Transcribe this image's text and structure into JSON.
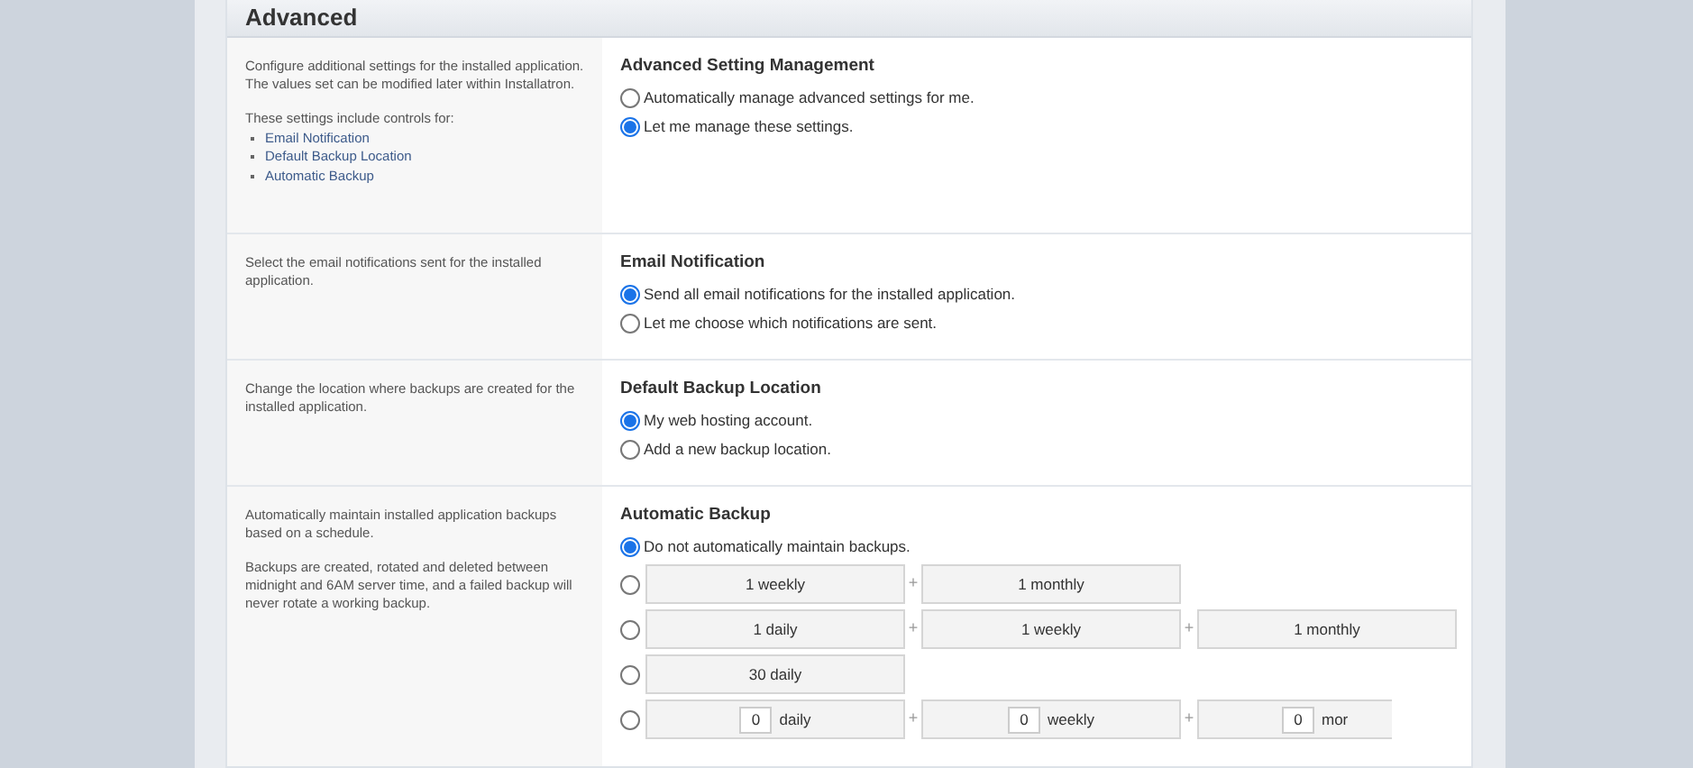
{
  "panel": {
    "title": "Advanced"
  },
  "sections": [
    {
      "description": [
        "Configure additional settings for the installed application. The values set can be modified later within Installatron.",
        "These settings include controls for:"
      ],
      "list": [
        "Email Notification",
        "Default Backup Location",
        "Automatic Backup"
      ],
      "heading": "Advanced Setting Management",
      "options": [
        {
          "kind": "text",
          "label": "Automatically manage advanced settings for me.",
          "selected": false
        },
        {
          "kind": "text",
          "label": "Let me manage these settings.",
          "selected": true
        }
      ]
    },
    {
      "description": [
        "Select the email notifications sent for the installed application."
      ],
      "heading": "Email Notification",
      "options": [
        {
          "kind": "text",
          "label": "Send all email notifications for the installed application.",
          "selected": true
        },
        {
          "kind": "text",
          "label": "Let me choose which notifications are sent.",
          "selected": false
        }
      ]
    },
    {
      "description": [
        "Change the location where backups are created for the installed application."
      ],
      "heading": "Default Backup Location",
      "options": [
        {
          "kind": "text",
          "label": "My web hosting account.",
          "selected": true
        },
        {
          "kind": "text",
          "label": "Add a new backup location.",
          "selected": false
        }
      ]
    },
    {
      "description": [
        "Automatically maintain installed application backups based on a schedule.",
        "Backups are created, rotated and deleted between midnight and 6AM server time, and a failed backup will never rotate a working backup."
      ],
      "heading": "Automatic Backup",
      "options": [
        {
          "kind": "text",
          "label": "Do not automatically maintain backups.",
          "selected": true
        },
        {
          "kind": "schedule",
          "selected": false,
          "parts": [
            {
              "label": "1 weekly"
            },
            {
              "joiner": "+",
              "label": "1 monthly"
            }
          ]
        },
        {
          "kind": "schedule",
          "selected": false,
          "parts": [
            {
              "label": "1 daily"
            },
            {
              "joiner": "+",
              "label": "1 weekly"
            },
            {
              "joiner": "+",
              "label": "1 monthly"
            }
          ]
        },
        {
          "kind": "schedule",
          "selected": false,
          "parts": [
            {
              "label": "30 daily"
            }
          ]
        },
        {
          "kind": "custom",
          "selected": false,
          "parts": [
            {
              "value": "0",
              "unit": "daily"
            },
            {
              "joiner": "+",
              "value": "0",
              "unit": "weekly"
            },
            {
              "joiner": "+",
              "value": "0",
              "unit": "mor"
            }
          ]
        }
      ]
    }
  ]
}
